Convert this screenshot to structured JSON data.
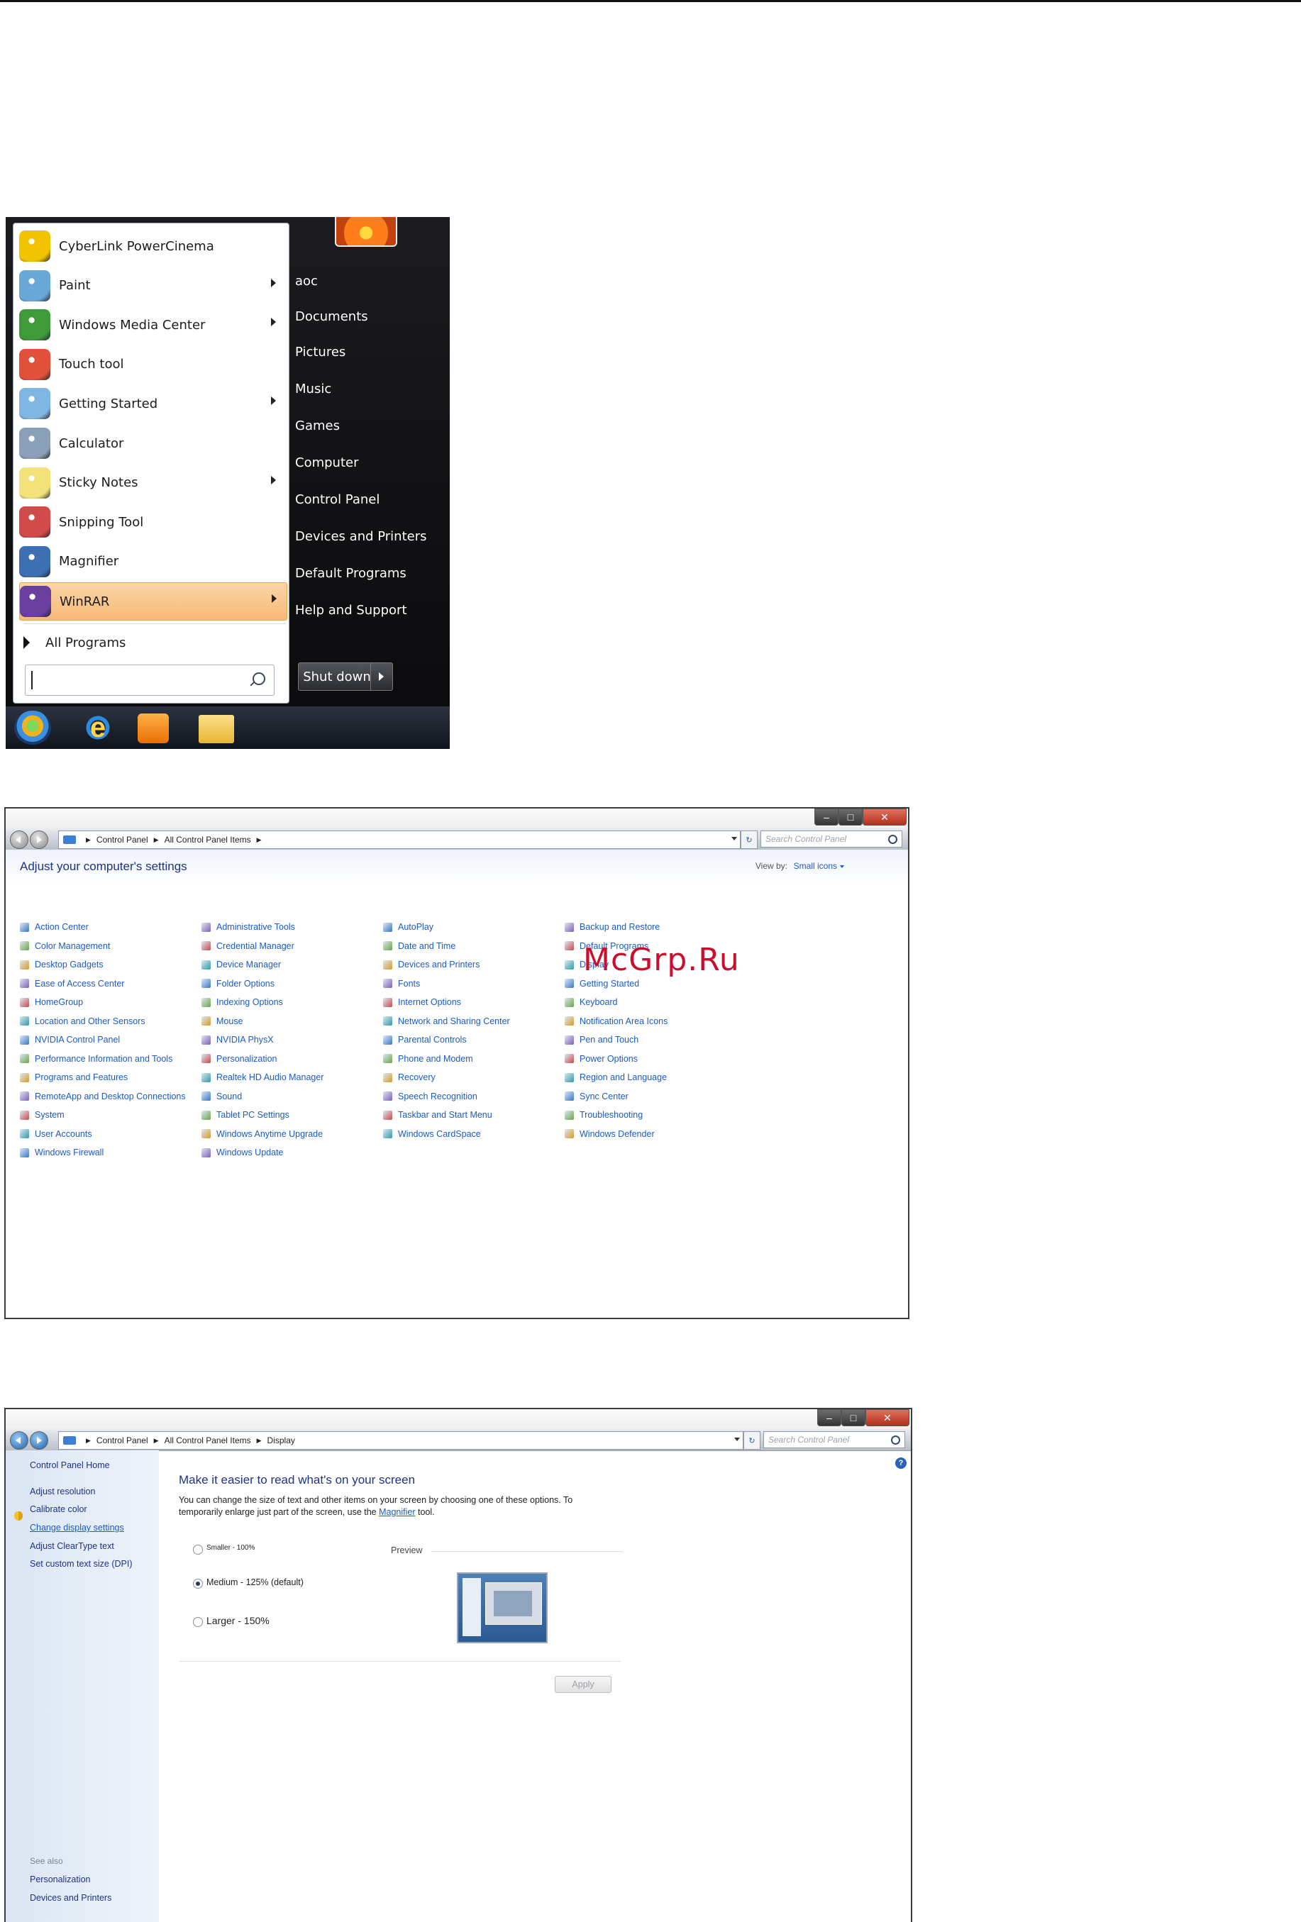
{
  "watermark": "McGrp.Ru",
  "start_menu": {
    "programs": [
      {
        "label": "CyberLink PowerCinema",
        "icon": "powercinema-icon",
        "color": "#f2c400",
        "arrow": false
      },
      {
        "label": "Paint",
        "icon": "paint-icon",
        "color": "#6aa8d8",
        "arrow": true
      },
      {
        "label": "Windows Media Center",
        "icon": "media-center-icon",
        "color": "#3f9a3a",
        "arrow": true
      },
      {
        "label": "Touch tool",
        "icon": "touch-tool-icon",
        "color": "#e0503a",
        "arrow": false
      },
      {
        "label": "Getting Started",
        "icon": "getting-started-icon",
        "color": "#7fb6e3",
        "arrow": true
      },
      {
        "label": "Calculator",
        "icon": "calculator-icon",
        "color": "#8aa0b8",
        "arrow": false
      },
      {
        "label": "Sticky Notes",
        "icon": "sticky-notes-icon",
        "color": "#f3e27a",
        "arrow": true
      },
      {
        "label": "Snipping Tool",
        "icon": "snipping-tool-icon",
        "color": "#d24a4a",
        "arrow": false
      },
      {
        "label": "Magnifier",
        "icon": "magnifier-icon",
        "color": "#3d6fb3",
        "arrow": false
      },
      {
        "label": "WinRAR",
        "icon": "winrar-icon",
        "color": "#6b3fa0",
        "arrow": true,
        "highlighted": true
      }
    ],
    "all_programs": "All Programs",
    "search_placeholder": "",
    "right_links": [
      "aoc",
      "Documents",
      "Pictures",
      "Music",
      "Games",
      "Computer",
      "Control Panel",
      "Devices and Printers",
      "Default Programs",
      "Help and Support"
    ],
    "shutdown_label": "Shut down",
    "taskbar_icons": [
      "start-orb-icon",
      "internet-explorer-icon",
      "media-player-icon",
      "explorer-folder-icon"
    ]
  },
  "control_panel": {
    "breadcrumb": [
      "Control Panel",
      "All Control Panel Items"
    ],
    "search_placeholder": "Search Control Panel",
    "title": "Adjust your computer's settings",
    "view_by_label": "View by:",
    "view_by_value": "Small icons",
    "columns": [
      [
        "Action Center",
        "Color Management",
        "Desktop Gadgets",
        "Ease of Access Center",
        "HomeGroup",
        "Location and Other Sensors",
        "NVIDIA Control Panel",
        "Performance Information and Tools",
        "Programs and Features",
        "RemoteApp and Desktop Connections",
        "System",
        "User Accounts",
        "Windows Firewall"
      ],
      [
        "Administrative Tools",
        "Credential Manager",
        "Device Manager",
        "Folder Options",
        "Indexing Options",
        "Mouse",
        "NVIDIA PhysX",
        "Personalization",
        "Realtek HD Audio Manager",
        "Sound",
        "Tablet PC Settings",
        "Windows Anytime Upgrade",
        "Windows Update"
      ],
      [
        "AutoPlay",
        "Date and Time",
        "Devices and Printers",
        "Fonts",
        "Internet Options",
        "Network and Sharing Center",
        "Parental Controls",
        "Phone and Modem",
        "Recovery",
        "Speech Recognition",
        "Taskbar and Start Menu",
        "Windows CardSpace"
      ],
      [
        "Backup and Restore",
        "Default Programs",
        "Display",
        "Getting Started",
        "Keyboard",
        "Notification Area Icons",
        "Pen and Touch",
        "Power Options",
        "Region and Language",
        "Sync Center",
        "Troubleshooting",
        "Windows Defender"
      ]
    ]
  },
  "display": {
    "breadcrumb": [
      "Control Panel",
      "All Control Panel Items",
      "Display"
    ],
    "search_placeholder": "Search Control Panel",
    "sidebar": {
      "home": "Control Panel Home",
      "links": [
        "Adjust resolution",
        "Calibrate color",
        "Change display settings",
        "Adjust ClearType text",
        "Set custom text size (DPI)"
      ],
      "see_also": "See also",
      "see_also_links": [
        "Personalization",
        "Devices and Printers"
      ]
    },
    "title": "Make it easier to read what's on your screen",
    "desc_line1": "You can change the size of text and other items on your screen by choosing one of these options. To",
    "desc_line2_pre": "temporarily enlarge just part of the screen, use the ",
    "desc_link": "Magnifier",
    "desc_line2_post": " tool.",
    "options": [
      {
        "label": "Smaller - 100%",
        "selected": false
      },
      {
        "label": "Medium - 125% (default)",
        "selected": true
      },
      {
        "label": "Larger - 150%",
        "selected": false
      }
    ],
    "preview_label": "Preview",
    "apply_label": "Apply"
  }
}
